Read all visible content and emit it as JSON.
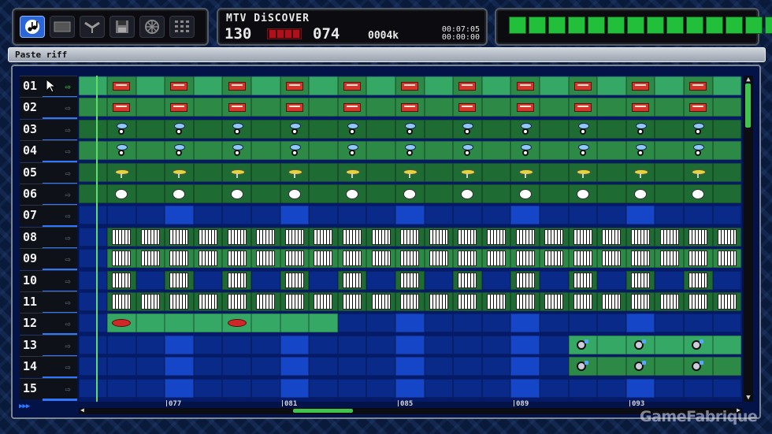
{
  "toolbar": {
    "tools": [
      {
        "name": "music-note-icon",
        "active": true
      },
      {
        "name": "tape-icon",
        "active": false
      },
      {
        "name": "mixer-icon",
        "active": false
      },
      {
        "name": "save-disk-icon",
        "active": false
      },
      {
        "name": "options-wheel-icon",
        "active": false
      },
      {
        "name": "grid-dots-icon",
        "active": false
      }
    ]
  },
  "info": {
    "song_name": "MTV DiSCOVER",
    "tempo": "130",
    "bar": "074",
    "memory": "0004k",
    "time_elapsed": "00:07:05",
    "time_remaining": "00:00:00"
  },
  "levels": {
    "count": 14,
    "color": "#22c03a"
  },
  "status": {
    "text": "Paste riff"
  },
  "tracks": [
    "01",
    "02",
    "03",
    "04",
    "05",
    "06",
    "07",
    "08",
    "09",
    "10",
    "11",
    "12",
    "13",
    "14",
    "15"
  ],
  "selected_track": "01",
  "ruler": {
    "labels": [
      "077",
      "081",
      "085",
      "089",
      "093"
    ]
  },
  "watermark": "GameFabrique",
  "colors": {
    "green_light": "#35a865",
    "green_mid": "#2c8a46",
    "green_dark": "#1f6b34",
    "blue_empty": "#0a2a8a",
    "blue_bright": "#1646c8"
  }
}
